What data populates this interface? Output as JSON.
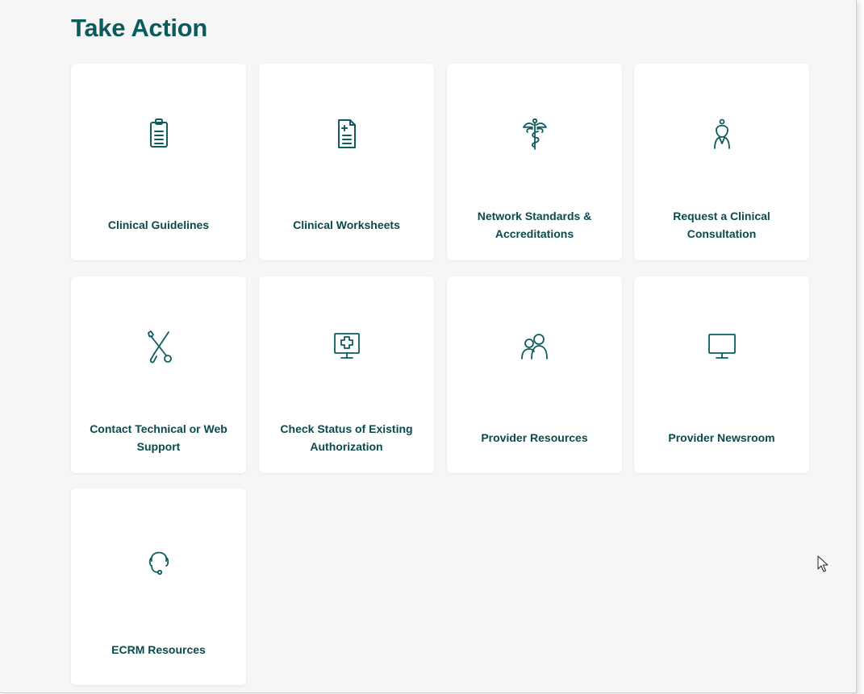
{
  "page": {
    "title": "Take Action"
  },
  "colors": {
    "accent": "#0b5a5c",
    "icon": "#0d5c5e",
    "tile_bg": "#ffffff",
    "page_bg": "#f6f6f6"
  },
  "tiles": [
    {
      "label": "Clinical Guidelines",
      "icon": "clipboard-icon"
    },
    {
      "label": "Clinical Worksheets",
      "icon": "medical-document-icon"
    },
    {
      "label": "Network Standards & Accreditations",
      "icon": "caduceus-icon"
    },
    {
      "label": "Request a Clinical Consultation",
      "icon": "doctor-icon"
    },
    {
      "label": "Contact Technical or Web Support",
      "icon": "tools-icon"
    },
    {
      "label": "Check Status of Existing Authorization",
      "icon": "medical-monitor-icon"
    },
    {
      "label": "Provider Resources",
      "icon": "people-icon"
    },
    {
      "label": "Provider Newsroom",
      "icon": "monitor-icon"
    },
    {
      "label": "ECRM Resources",
      "icon": "headset-icon"
    }
  ]
}
